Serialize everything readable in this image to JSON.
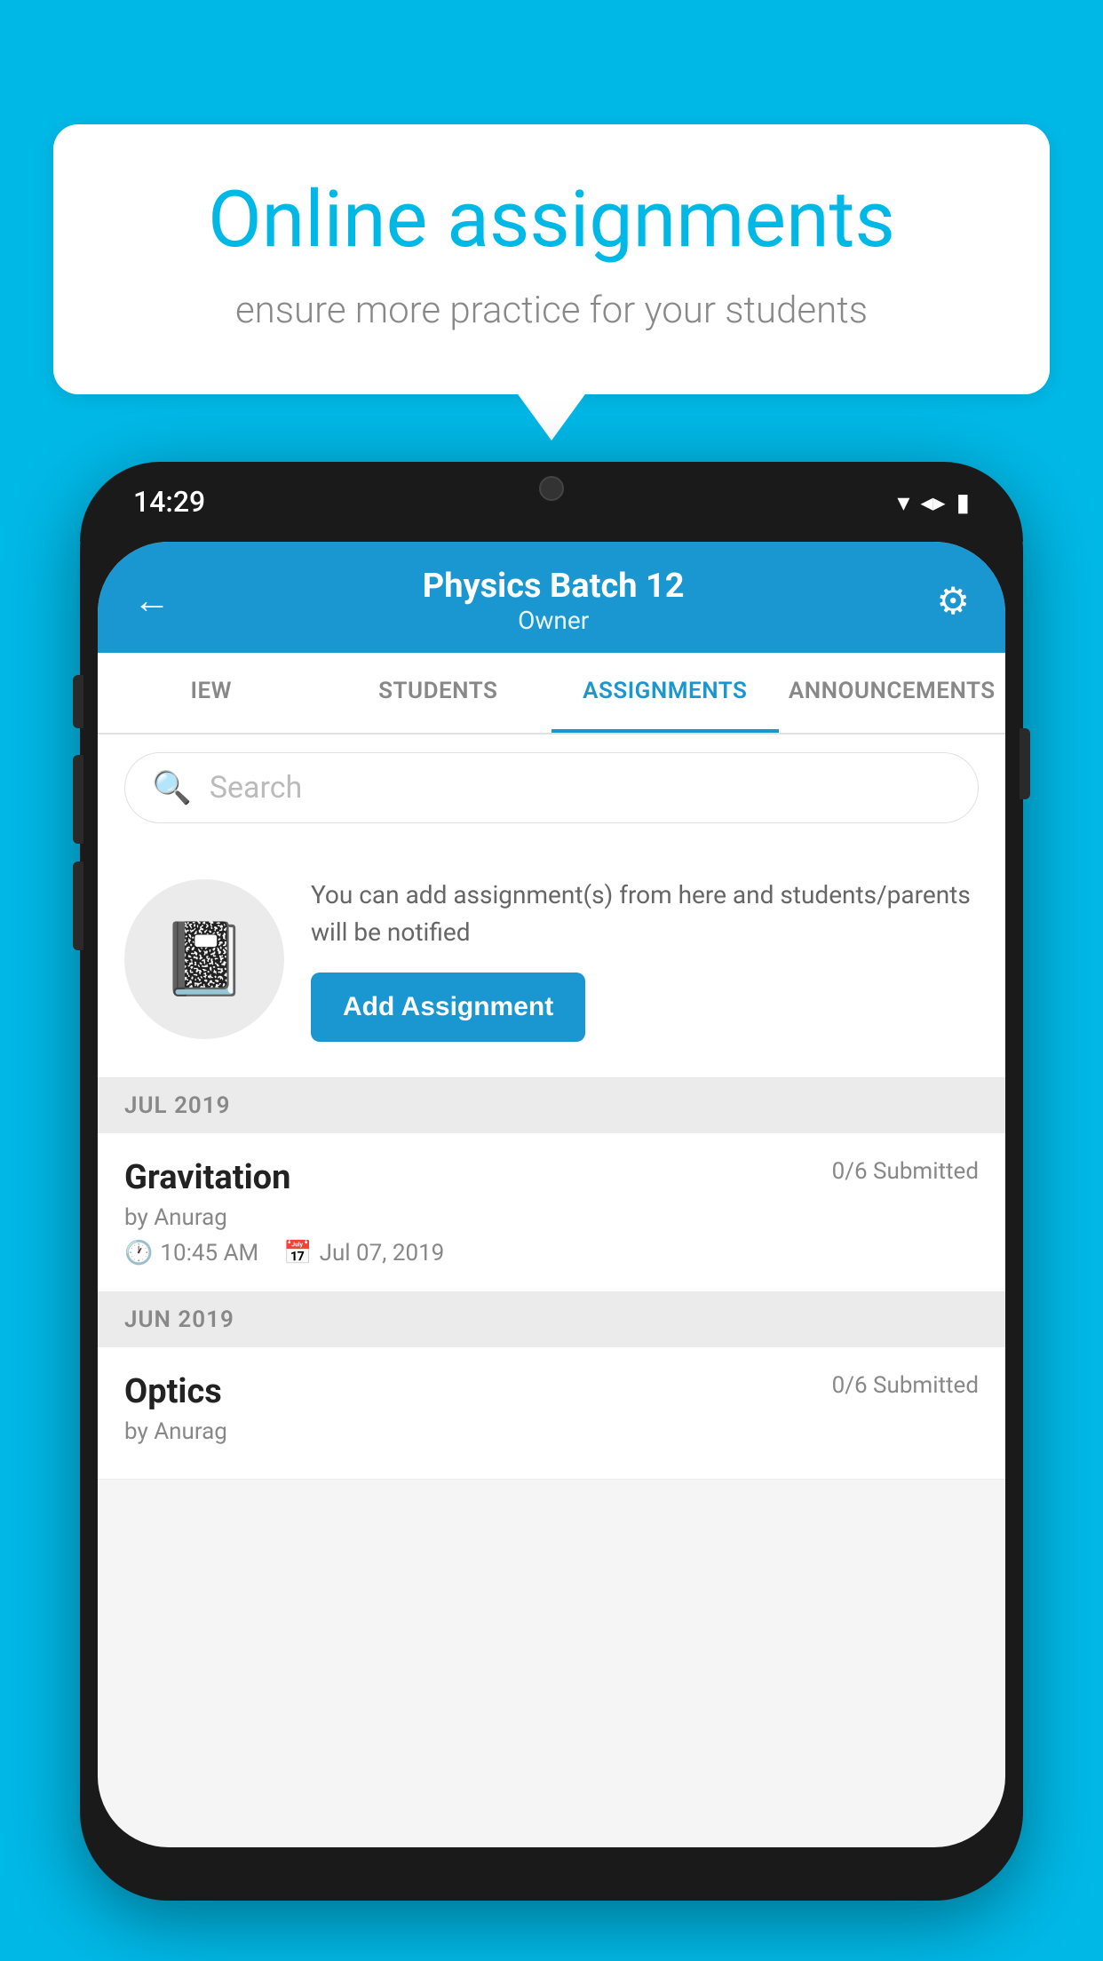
{
  "background_color": "#00b8e6",
  "speech_bubble": {
    "title": "Online assignments",
    "subtitle": "ensure more practice for your students"
  },
  "phone": {
    "status_bar": {
      "time": "14:29",
      "icons": [
        "wifi",
        "signal",
        "battery"
      ]
    },
    "header": {
      "title": "Physics Batch 12",
      "subtitle": "Owner",
      "back_label": "←",
      "gear_label": "⚙"
    },
    "tabs": [
      {
        "label": "IEW",
        "active": false
      },
      {
        "label": "STUDENTS",
        "active": false
      },
      {
        "label": "ASSIGNMENTS",
        "active": true
      },
      {
        "label": "ANNOUNCEMENTS",
        "active": false
      }
    ],
    "search": {
      "placeholder": "Search"
    },
    "promo": {
      "description": "You can add assignment(s) from here and students/parents will be notified",
      "button_label": "Add Assignment"
    },
    "sections": [
      {
        "month_label": "JUL 2019",
        "assignments": [
          {
            "name": "Gravitation",
            "submitted": "0/6 Submitted",
            "by": "by Anurag",
            "time": "10:45 AM",
            "date": "Jul 07, 2019"
          }
        ]
      },
      {
        "month_label": "JUN 2019",
        "assignments": [
          {
            "name": "Optics",
            "submitted": "0/6 Submitted",
            "by": "by Anurag",
            "time": "",
            "date": ""
          }
        ]
      }
    ]
  }
}
